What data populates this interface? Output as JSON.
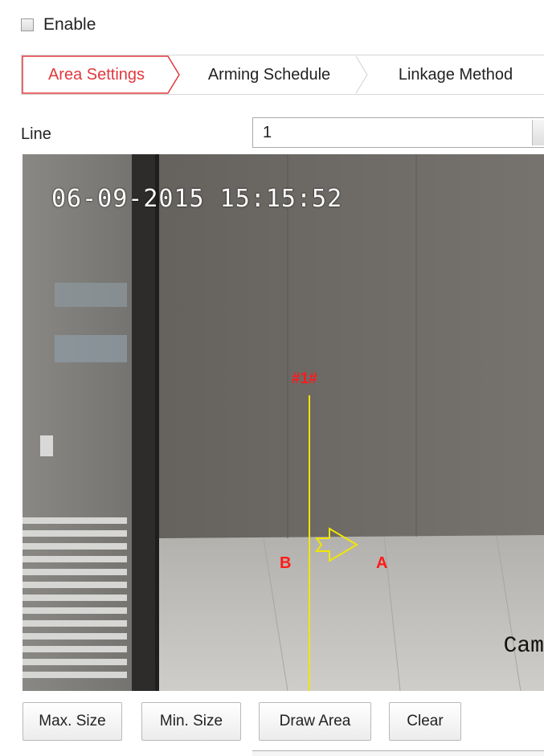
{
  "enable": {
    "label": "Enable",
    "checked": false
  },
  "tabs": [
    {
      "label": "Area Settings",
      "active": true
    },
    {
      "label": "Arming Schedule",
      "active": false
    },
    {
      "label": "Linkage Method",
      "active": false
    }
  ],
  "line": {
    "label": "Line",
    "selected": "1"
  },
  "video": {
    "timestamp": "06-09-2015 15:15:52",
    "rule_id": "#1#",
    "side_a": "A",
    "side_b": "B",
    "camera_label": "Cam",
    "line_color": "#f2e600",
    "label_color": "#ff1a1a"
  },
  "buttons": {
    "max_size": "Max. Size",
    "min_size": "Min. Size",
    "draw_area": "Draw Area",
    "clear": "Clear"
  },
  "colors": {
    "accent": "#e0393e"
  }
}
